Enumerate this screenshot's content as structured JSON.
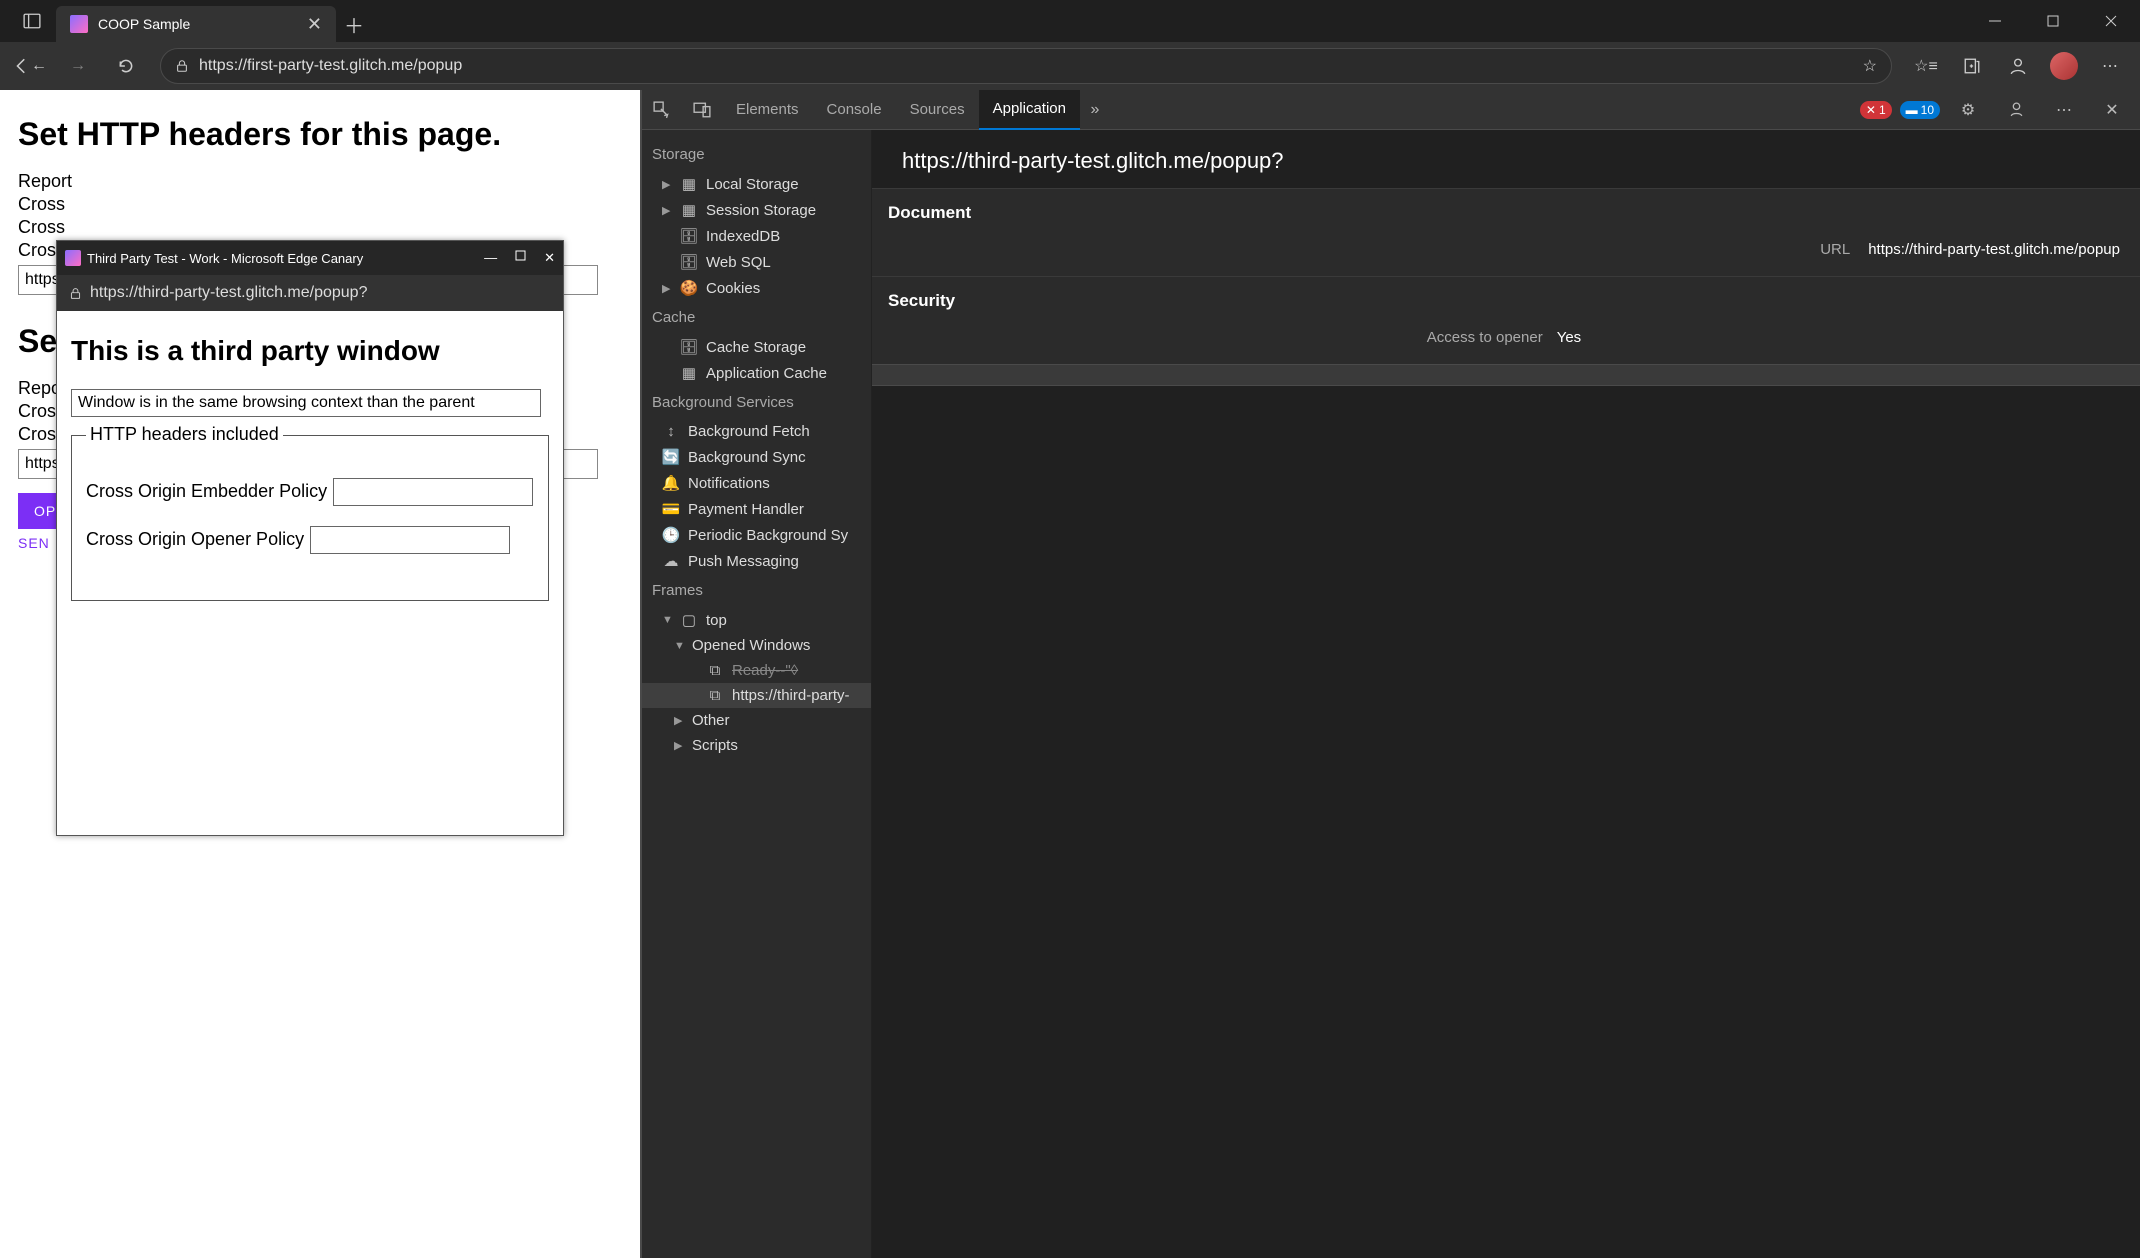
{
  "browser": {
    "tab_title": "COOP Sample",
    "address_url": "https://first-party-test.glitch.me/popup"
  },
  "page": {
    "heading1": "Set HTTP headers for this page.",
    "report_to": "Report",
    "cross1": "Cross",
    "cross2": "Cross",
    "cross3": "Cross",
    "heading2": "Set",
    "heading2_suffix": ".",
    "input1_value": "https:/",
    "input2_value": "https:/",
    "btn_open": "OP",
    "link_send": "SEN"
  },
  "popup": {
    "title": "Third Party Test - Work - Microsoft Edge Canary",
    "url": "https://third-party-test.glitch.me/popup?",
    "heading": "This is a third party window",
    "status_msg": "Window is in the same browsing context than the parent",
    "fieldset_legend": "HTTP headers included",
    "coep_label": "Cross Origin Embedder Policy",
    "coop_label": "Cross Origin Opener Policy"
  },
  "devtools": {
    "tabs": {
      "elements": "Elements",
      "console": "Console",
      "sources": "Sources",
      "application": "Application"
    },
    "errors": "1",
    "infos": "10",
    "sidebar": {
      "storage_hdr": "Storage",
      "local_storage": "Local Storage",
      "session_storage": "Session Storage",
      "indexeddb": "IndexedDB",
      "websql": "Web SQL",
      "cookies": "Cookies",
      "cache_hdr": "Cache",
      "cache_storage": "Cache Storage",
      "app_cache": "Application Cache",
      "bg_hdr": "Background Services",
      "bg_fetch": "Background Fetch",
      "bg_sync": "Background Sync",
      "notifications": "Notifications",
      "payment": "Payment Handler",
      "periodic": "Periodic Background Sy",
      "push": "Push Messaging",
      "frames_hdr": "Frames",
      "frame_top": "top",
      "opened_windows": "Opened Windows",
      "ready_item": "Ready--\"◊",
      "popup_item": "https://third-party-",
      "other": "Other",
      "scripts": "Scripts"
    },
    "main": {
      "url_header": "https://third-party-test.glitch.me/popup?",
      "document_hdr": "Document",
      "url_key": "URL",
      "url_val": "https://third-party-test.glitch.me/popup",
      "security_hdr": "Security",
      "access_key": "Access to opener",
      "access_val": "Yes"
    }
  }
}
